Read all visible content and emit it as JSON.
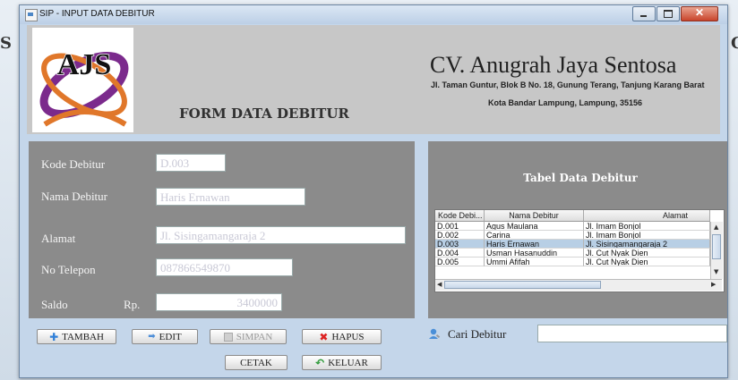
{
  "window": {
    "title": "SIP - INPUT DATA DEBITUR"
  },
  "header": {
    "logo_text": "AJS",
    "form_title": "FORM DATA DEBITUR",
    "company_name": "CV. Anugrah Jaya Sentosa",
    "address_line1": "Jl. Taman Guntur, Blok B No. 18, Gunung Terang, Tanjung Karang Barat",
    "address_line2": "Kota Bandar Lampung, Lampung, 35156"
  },
  "form": {
    "kode_label": "Kode Debitur",
    "kode_value": "D.003",
    "nama_label": "Nama Debitur",
    "nama_value": "Haris Ernawan",
    "alamat_label": "Alamat",
    "alamat_value": "Jl. Sisingamangaraja 2",
    "telepon_label": "No Telepon",
    "telepon_value": "087866549870",
    "saldo_label": "Saldo",
    "saldo_currency": "Rp.",
    "saldo_value": "3400000"
  },
  "table": {
    "title": "Tabel Data Debitur",
    "columns": [
      "Kode Debi...",
      "Nama Debitur",
      "Alamat"
    ],
    "rows": [
      [
        "D.001",
        "Agus Maulana",
        "Jl. Imam Bonjol"
      ],
      [
        "D.002",
        "Carina",
        "Jl. Imam Bonjol"
      ],
      [
        "D.003",
        "Haris Ernawan",
        "Jl. Sisingamangaraja 2"
      ],
      [
        "D.004",
        "Usman Hasanuddin",
        "Jl. Cut Nyak Dien"
      ],
      [
        "D.005",
        "Ummi Afifah",
        "Jl. Cut Nyak Dien"
      ]
    ],
    "selected_row": 2
  },
  "buttons": {
    "tambah": "TAMBAH",
    "edit": "EDIT",
    "simpan": "SIMPAN",
    "hapus": "HAPUS",
    "cetak": "CETAK",
    "keluar": "KELUAR"
  },
  "search": {
    "label": "Cari Debitur",
    "value": ""
  },
  "background": {
    "edge_left": "S",
    "edge_right": "G"
  },
  "colors": {
    "header_bg": "#c7c7c7",
    "panel_bg": "#8b8b8b",
    "window_bg": "#c4d6ea",
    "selection": "#b8cfe5"
  }
}
